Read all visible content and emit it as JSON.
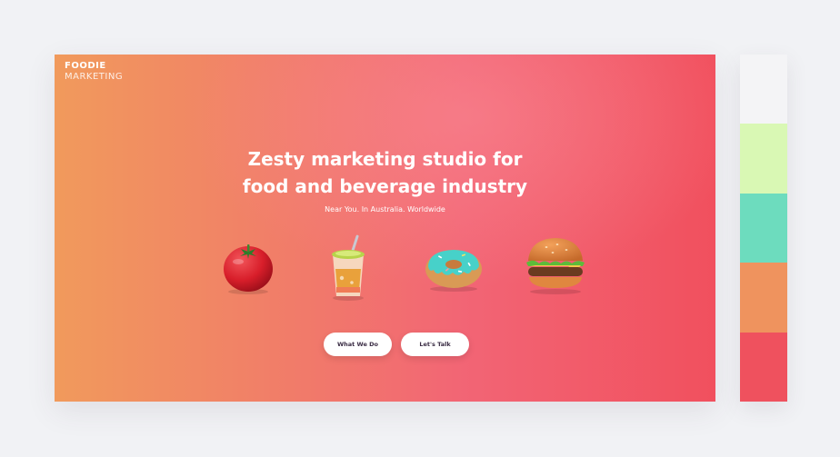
{
  "brand": {
    "name": "FOODIE",
    "subtitle": "MARKETING"
  },
  "hero": {
    "headline_line1": "Zesty marketing studio for",
    "headline_line2": "food and beverage industry",
    "tagline": "Near You. In Australia. Worldwide",
    "food_icons": [
      "tomato-icon",
      "drink-cup-icon",
      "donut-icon",
      "burger-icon"
    ]
  },
  "buttons": {
    "what_we_do": "What We Do",
    "lets_talk": "Let's Talk"
  },
  "palette": {
    "colors": [
      "#f4f4f6",
      "#d9f8b4",
      "#6ddcbe",
      "#ef935e",
      "#ef515e"
    ]
  }
}
